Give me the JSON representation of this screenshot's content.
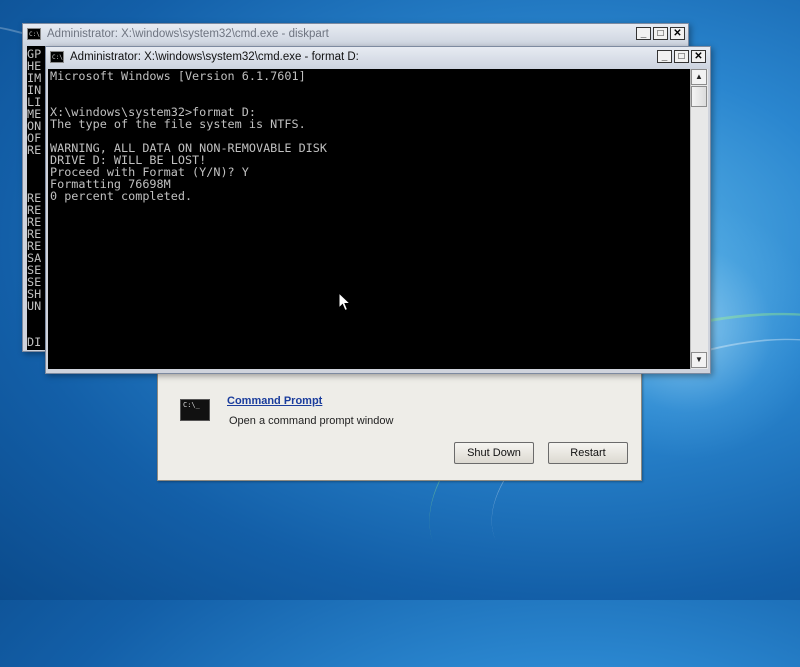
{
  "desktop": {
    "accent": "#2a86cf"
  },
  "recovery_dialog": {
    "tool_name": "Command Prompt",
    "tool_description": "Open a command prompt window",
    "shutdown_label": "Shut Down",
    "restart_label": "Restart",
    "thumb_text": "C:\\_"
  },
  "background_window": {
    "title": "Administrator: X:\\windows\\system32\\cmd.exe - diskpart",
    "icon_text": "C:\\",
    "lines": [
      "GP",
      "HE",
      "IM",
      "IN",
      "LI",
      "ME",
      "ON",
      "OF",
      "RE",
      "",
      "",
      "",
      "RE",
      "RE",
      "RE",
      "RE",
      "RE",
      "SA",
      "SE",
      "SE",
      "SH",
      "UN",
      "",
      "",
      "DI"
    ]
  },
  "foreground_window": {
    "title": "Administrator: X:\\windows\\system32\\cmd.exe - format  D:",
    "icon_text": "C:\\",
    "lines": [
      "Microsoft Windows [Version 6.1.7601]",
      "",
      "",
      "X:\\windows\\system32>format D:",
      "The type of the file system is NTFS.",
      "",
      "WARNING, ALL DATA ON NON-REMOVABLE DISK",
      "DRIVE D: WILL BE LOST!",
      "Proceed with Format (Y/N)? Y",
      "Formatting 76698M",
      "0 percent completed."
    ]
  },
  "titlebar_buttons": {
    "minimize": "_",
    "maximize": "□",
    "close": "✕"
  },
  "scroll": {
    "up": "▲",
    "down": "▼"
  }
}
